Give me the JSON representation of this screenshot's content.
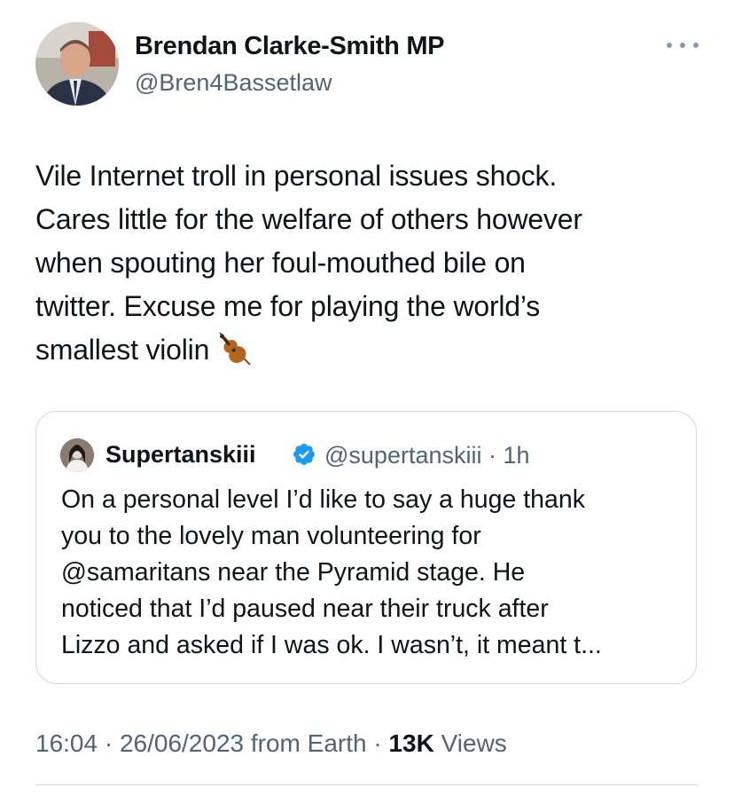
{
  "tweet": {
    "author": {
      "name": "Brendan Clarke-Smith MP",
      "handle": "@Bren4Bassetlaw"
    },
    "text_lines": [
      "Vile Internet troll in personal issues shock.",
      "Cares little for the welfare of others however",
      "when spouting her foul-mouthed bile on",
      "twitter. Excuse me for playing the world’s",
      "smallest violin"
    ],
    "emoji": "violin-icon",
    "quoted": {
      "name": "Supertanskiii",
      "verified": true,
      "handle_time": "@supertanskiii · 1h",
      "text_lines": [
        "On a personal level I’d like to say a huge thank",
        "you to the lovely man volunteering for",
        "@samaritans near the Pyramid stage. He",
        "noticed that I’d paused near their truck after",
        "Lizzo and asked if I was ok. I wasn’t, it meant t..."
      ]
    },
    "meta": {
      "timestamp": "16:04 · 26/06/2023 from Earth · ",
      "views_count": "13K",
      "views_label": " Views"
    }
  },
  "colors": {
    "text": "#0f1419",
    "secondary": "#536471",
    "border": "#cfd9de",
    "verified": "#1d9bf0"
  }
}
